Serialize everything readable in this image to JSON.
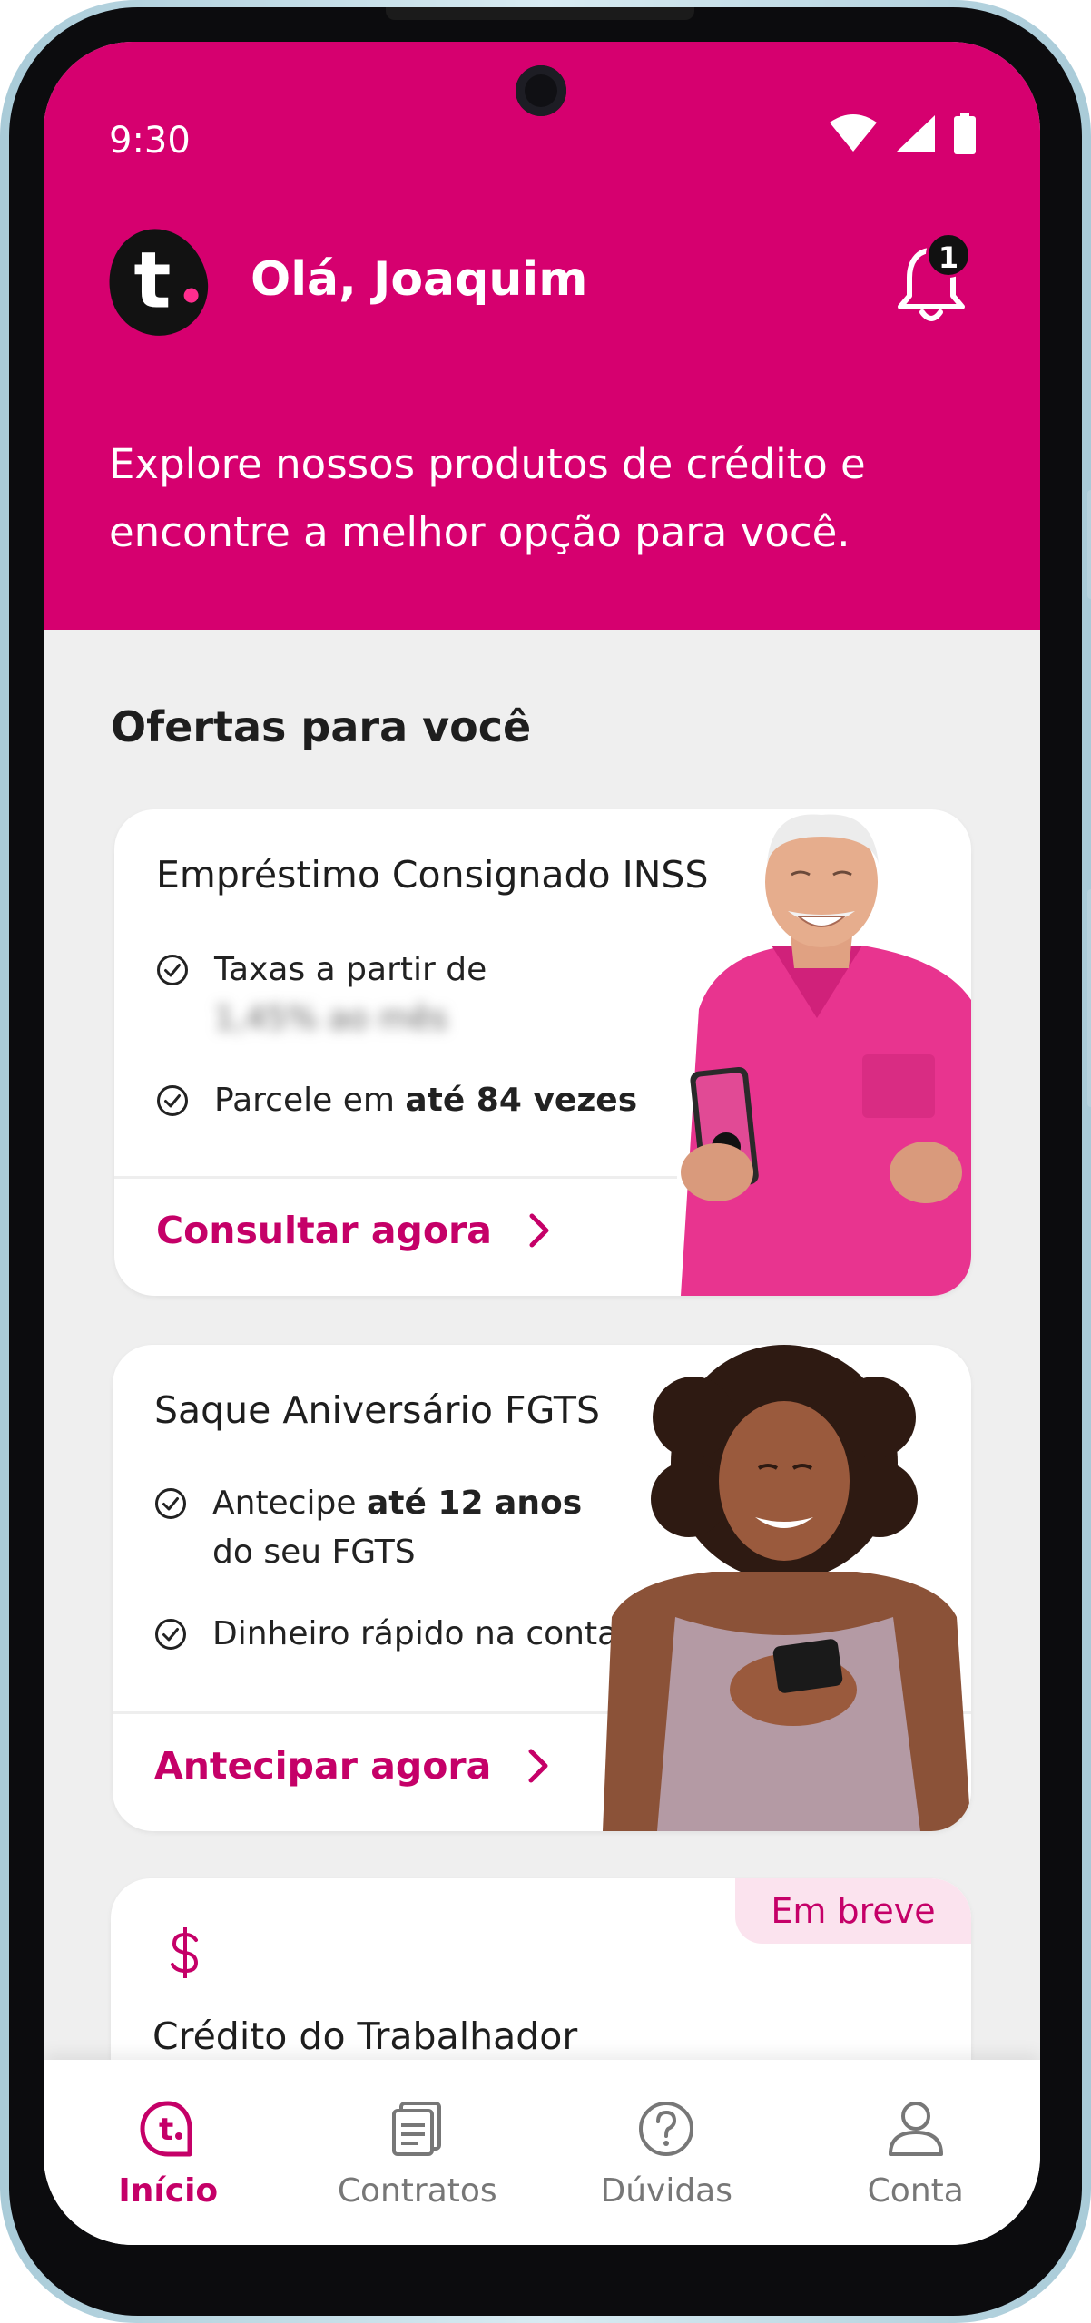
{
  "status_bar": {
    "time": "9:30"
  },
  "header": {
    "logo_letter": "t",
    "greeting": "Olá, Joaquim",
    "notification_count": "1",
    "intro": "Explore nossos produtos de crédito e encontre a melhor opção para você."
  },
  "offers": {
    "title": "Ofertas para você",
    "cards": [
      {
        "title": "Empréstimo Consignado INSS",
        "features": [
          {
            "text": "Taxas a partir de",
            "blurred_line": "1,45% ao mês"
          },
          {
            "text_before": "Parcele em ",
            "bold": "até 84 vezes"
          }
        ],
        "cta": "Consultar agora"
      },
      {
        "title": "Saque Aniversário FGTS",
        "features": [
          {
            "text_before": "Antecipe ",
            "bold": "até 12 anos",
            "line2": "do seu FGTS"
          },
          {
            "text": "Dinheiro rápido na conta"
          }
        ],
        "cta": "Antecipar agora"
      },
      {
        "badge": "Em breve",
        "icon": "dollar-icon",
        "title": "Crédito do Trabalhador"
      }
    ]
  },
  "bottom_nav": {
    "items": [
      {
        "label": "Início",
        "icon": "home-logo-icon",
        "active": true
      },
      {
        "label": "Contratos",
        "icon": "contracts-icon",
        "active": false
      },
      {
        "label": "Dúvidas",
        "icon": "help-icon",
        "active": false
      },
      {
        "label": "Conta",
        "icon": "account-icon",
        "active": false
      }
    ]
  },
  "colors": {
    "brand": "#d6006f",
    "brand_text": "#c50068",
    "badge_bg": "#fbe3ee",
    "screen_bg": "#efefef"
  }
}
